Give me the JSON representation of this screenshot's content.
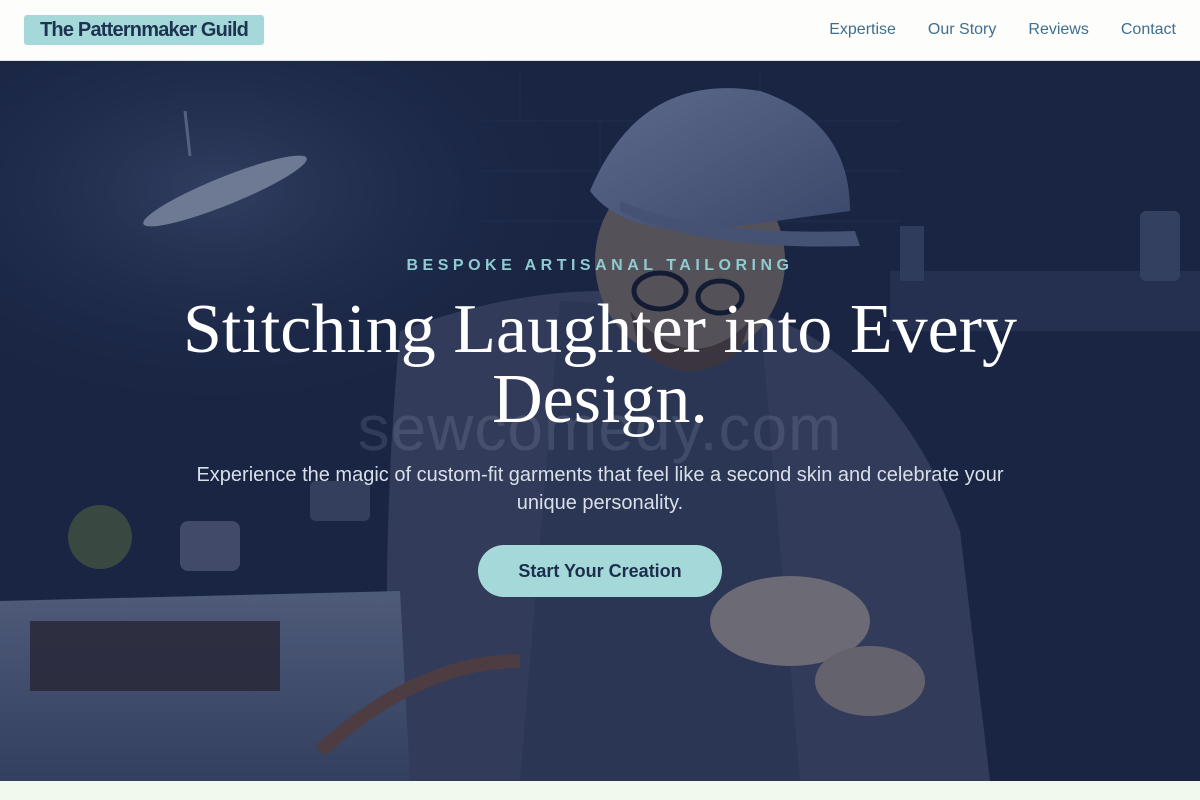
{
  "header": {
    "logo_text": "The Patternmaker Guild",
    "nav": [
      {
        "label": "Expertise"
      },
      {
        "label": "Our Story"
      },
      {
        "label": "Reviews"
      },
      {
        "label": "Contact"
      }
    ]
  },
  "hero": {
    "eyebrow": "BESPOKE ARTISANAL TAILORING",
    "headline": "Stitching Laughter into Every Design.",
    "subtext": "Experience the magic of custom-fit garments that feel like a second skin and celebrate your unique personality.",
    "cta_label": "Start Your Creation",
    "watermark": "sewcomedy.com"
  },
  "colors": {
    "accent": "#a5d9d9",
    "header_bg": "#fdfefc",
    "nav_text": "#3f6e8e",
    "hero_overlay": "#1c2745",
    "eyebrow": "#8fcbd1"
  }
}
